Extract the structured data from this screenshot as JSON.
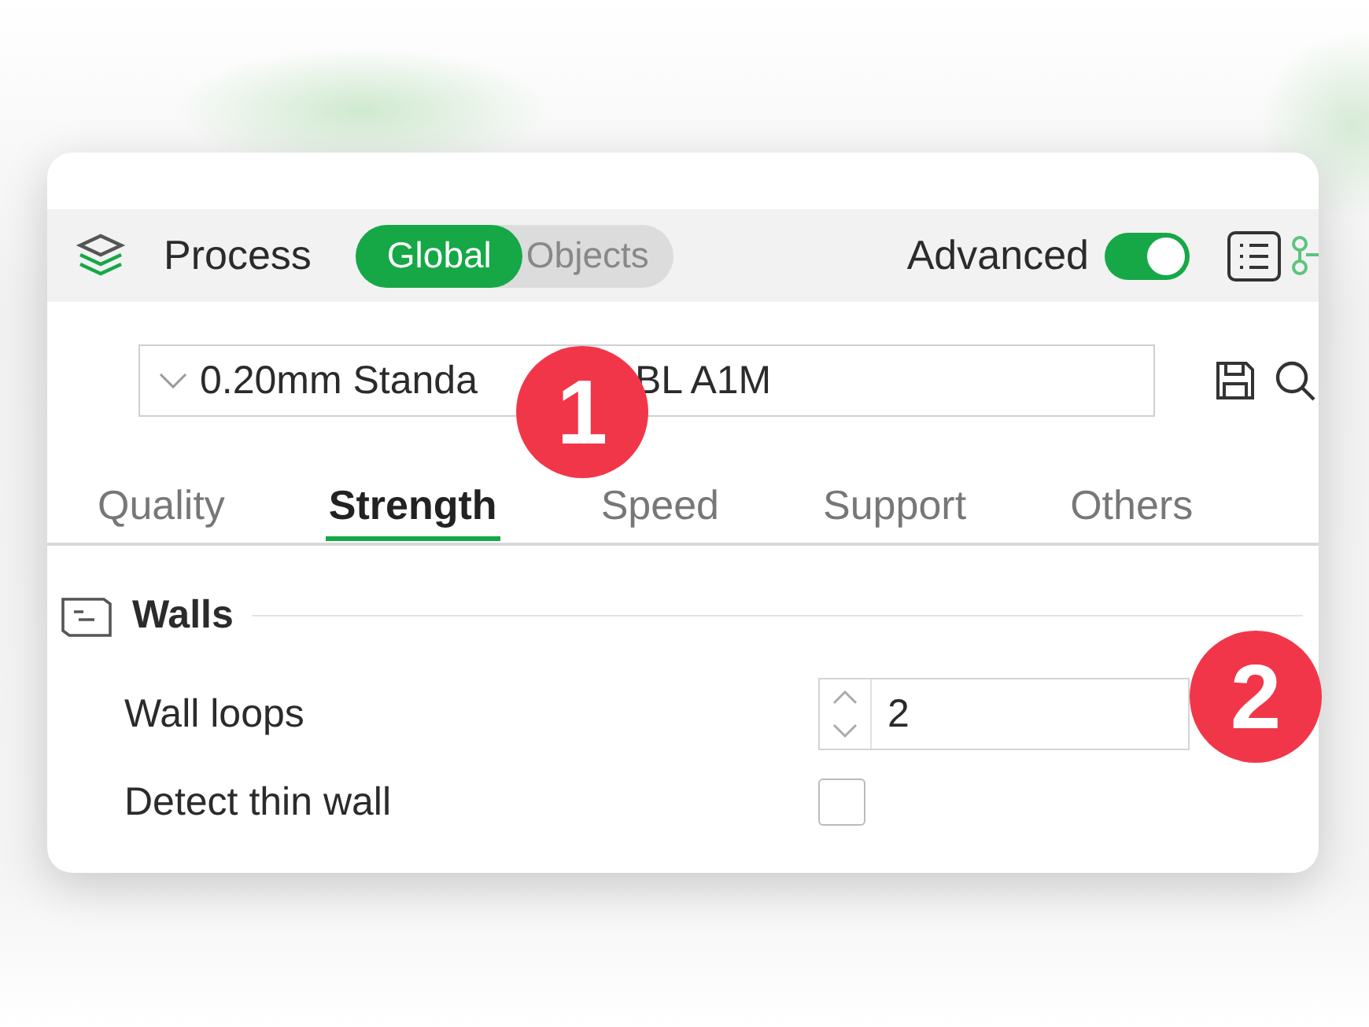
{
  "header": {
    "title": "Process",
    "scope_tabs": [
      {
        "label": "Global",
        "selected": true
      },
      {
        "label": "Objects",
        "selected": false
      }
    ],
    "advanced": {
      "label": "Advanced",
      "on": true
    }
  },
  "preset": {
    "text_before": "0.20mm Standa",
    "text_after": "BL A1M"
  },
  "tabs": [
    {
      "label": "Quality",
      "selected": false
    },
    {
      "label": "Strength",
      "selected": true
    },
    {
      "label": "Speed",
      "selected": false
    },
    {
      "label": "Support",
      "selected": false
    },
    {
      "label": "Others",
      "selected": false
    }
  ],
  "section": {
    "title": "Walls"
  },
  "settings": [
    {
      "kind": "number",
      "label": "Wall loops",
      "value": "2"
    },
    {
      "kind": "checkbox",
      "label": "Detect thin wall",
      "checked": false
    }
  ],
  "badges": [
    "1",
    "2"
  ]
}
